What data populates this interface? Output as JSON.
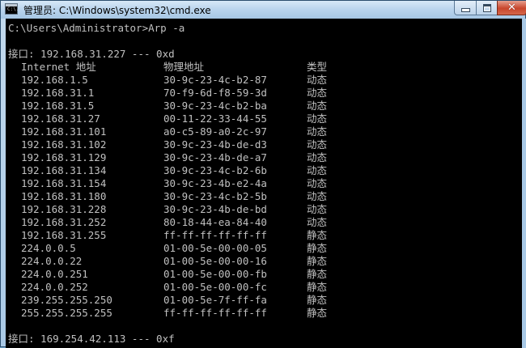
{
  "window": {
    "title": "管理员: C:\\Windows\\system32\\cmd.exe",
    "icon_text": "C:\\.",
    "buttons": {
      "minimize": "minimize",
      "maximize": "maximize",
      "close": "✕"
    }
  },
  "console": {
    "command_line": "C:\\Users\\Administrator>Arp -a",
    "interface1_header": "接口: 192.168.31.227 --- 0xd",
    "columns": [
      "Internet 地址",
      "物理地址",
      "类型"
    ],
    "rows": [
      [
        "192.168.1.5",
        "30-9c-23-4c-b2-87",
        "动态"
      ],
      [
        "192.168.31.1",
        "70-f9-6d-f8-59-3d",
        "动态"
      ],
      [
        "192.168.31.5",
        "30-9c-23-4c-b2-ba",
        "动态"
      ],
      [
        "192.168.31.27",
        "00-11-22-33-44-55",
        "动态"
      ],
      [
        "192.168.31.101",
        "a0-c5-89-a0-2c-97",
        "动态"
      ],
      [
        "192.168.31.102",
        "30-9c-23-4b-de-d3",
        "动态"
      ],
      [
        "192.168.31.129",
        "30-9c-23-4b-de-a7",
        "动态"
      ],
      [
        "192.168.31.134",
        "30-9c-23-4c-b2-6b",
        "动态"
      ],
      [
        "192.168.31.154",
        "30-9c-23-4b-e2-4a",
        "动态"
      ],
      [
        "192.168.31.180",
        "30-9c-23-4c-b2-5b",
        "动态"
      ],
      [
        "192.168.31.228",
        "30-9c-23-4b-de-bd",
        "动态"
      ],
      [
        "192.168.31.252",
        "80-18-44-ea-84-40",
        "动态"
      ],
      [
        "192.168.31.255",
        "ff-ff-ff-ff-ff-ff",
        "静态"
      ],
      [
        "224.0.0.5",
        "01-00-5e-00-00-05",
        "静态"
      ],
      [
        "224.0.0.22",
        "01-00-5e-00-00-16",
        "静态"
      ],
      [
        "224.0.0.251",
        "01-00-5e-00-00-fb",
        "静态"
      ],
      [
        "224.0.0.252",
        "01-00-5e-00-00-fc",
        "静态"
      ],
      [
        "239.255.255.250",
        "01-00-5e-7f-ff-fa",
        "静态"
      ],
      [
        "255.255.255.255",
        "ff-ff-ff-ff-ff-ff",
        "静态"
      ]
    ],
    "interface2_header": "接口: 169.254.42.113 --- 0xf"
  },
  "colors": {
    "console_bg": "#000000",
    "console_fg": "#c0c0c0",
    "titlebar": "#b9d4ed",
    "close_button": "#c8462c"
  }
}
